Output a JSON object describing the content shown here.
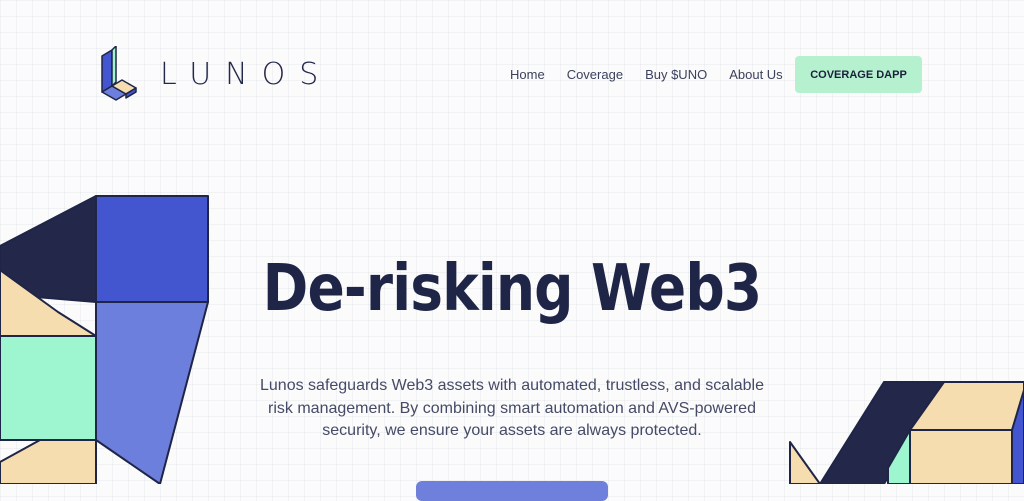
{
  "header": {
    "logo_text": "LUNOS",
    "nav": [
      "Home",
      "Coverage",
      "Buy $UNO",
      "About Us"
    ],
    "cta_label": "COVERAGE DAPP"
  },
  "hero": {
    "title": "De-risking Web3",
    "description": "Lunos safeguards Web3 assets with automated, trustless, and scalable risk management. By combining smart automation and AVS-powered security, we ensure your assets are always protected."
  },
  "colors": {
    "navy": "#1f2547",
    "blue": "#4355cf",
    "periwinkle": "#6d7fdc",
    "mint": "#9ef6d0",
    "peach": "#f5ddb0",
    "cta_bg": "#b5f1cf",
    "background": "#fbfbfc"
  }
}
